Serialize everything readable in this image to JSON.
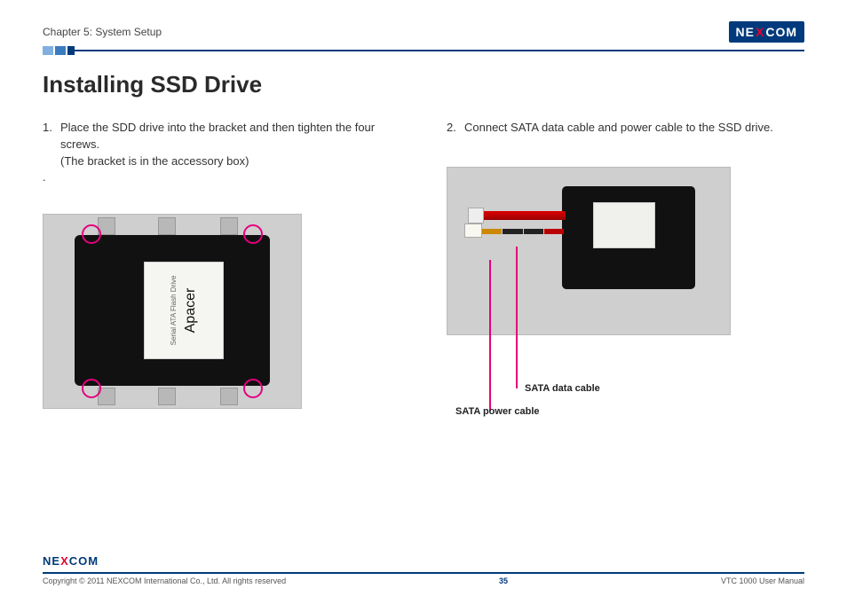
{
  "header": {
    "chapter": "Chapter 5: System Setup",
    "logo_text_pre": "NE",
    "logo_text_x": "X",
    "logo_text_post": "COM"
  },
  "title": "Installing SSD Drive",
  "left": {
    "step_num": "1.",
    "step_line1": "Place the SDD drive into the bracket and then tighten the four screws.",
    "step_line2": "(The bracket  is in the accessory box)",
    "dot": ".",
    "ssd_label_small": "Serial ATA Flash Drive",
    "ssd_brand": "Apacer"
  },
  "right": {
    "step_num": "2.",
    "step_text": "Connect SATA data cable and power cable to the SSD drive.",
    "label_data": "SATA data cable",
    "label_power": "SATA power cable"
  },
  "footer": {
    "copyright": "Copyright © 2011 NEXCOM International Co., Ltd. All rights reserved",
    "page": "35",
    "manual": "VTC 1000 User Manual"
  }
}
